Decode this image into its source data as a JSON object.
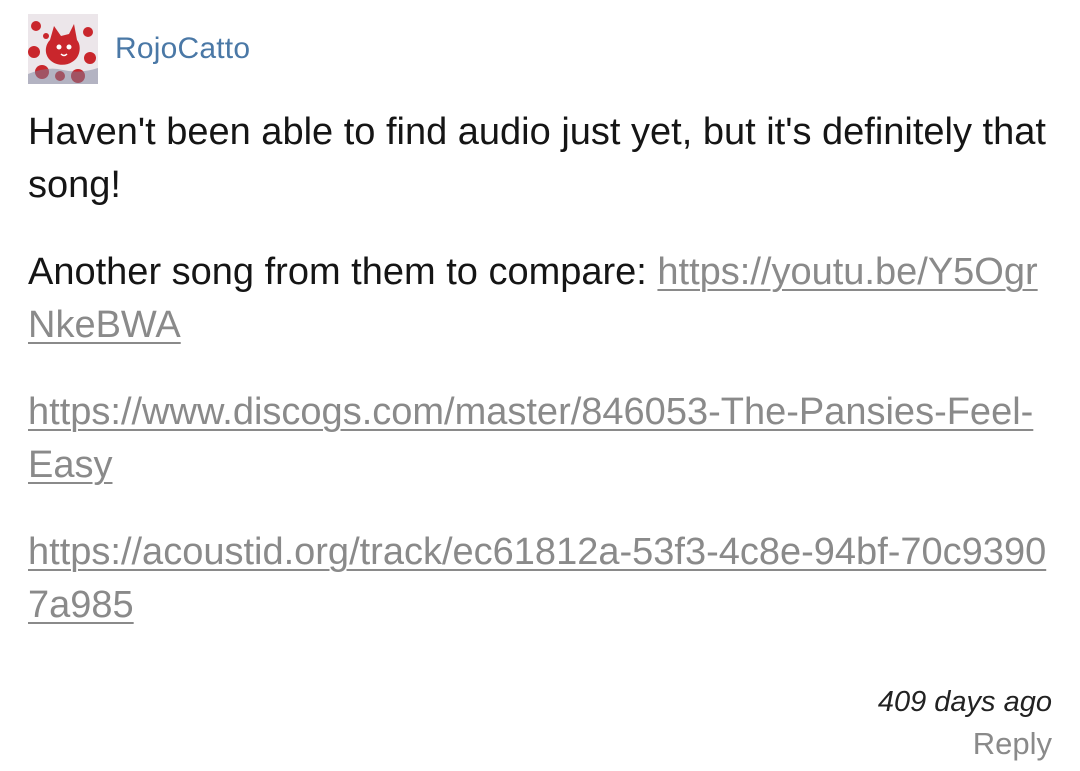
{
  "comment": {
    "author": "RojoCatto",
    "avatar_icon": "red-cat-avatar-icon",
    "paragraph1": "Haven't been able to find audio just yet, but it's definitely that song!",
    "paragraph2_text": "Another song from them to compare: ",
    "paragraph2_link": "https://youtu.be/Y5OgrNkeBWA",
    "link2": "https://www.discogs.com/master/846053-The-Pansies-Feel-Easy",
    "link3": "https://acoustid.org/track/ec61812a-53f3-4c8e-94bf-70c93907a985",
    "timestamp": "409 days ago",
    "reply_label": "Reply"
  },
  "colors": {
    "username": "#4a78a6",
    "link": "#8a8a8a",
    "text": "#151515"
  }
}
